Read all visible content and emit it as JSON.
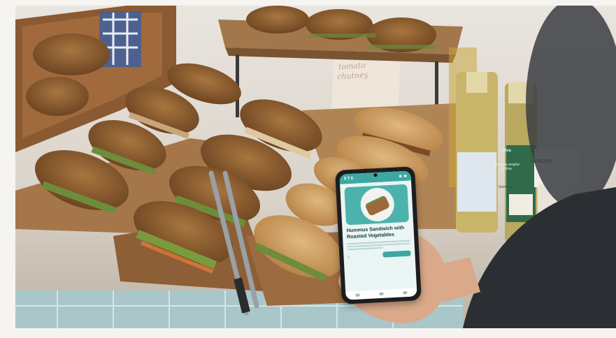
{
  "scene": {
    "description_hidden": "",
    "sign": {
      "line1": "tomato",
      "line2": "chutney"
    },
    "bottle_labels": {
      "label_brand": "oliva",
      "label_oil": "olio extra vergine di oliva",
      "label_variant": "rosmarino",
      "box_text": "VERGINE"
    }
  },
  "phone": {
    "app_name": "STX",
    "product_title": "Hummus Sandwich with Roasted Vegetables",
    "product_price": "€",
    "icons": [
      "search-icon",
      "cart-icon"
    ]
  },
  "colors": {
    "app_accent": "#3ea7a1",
    "screen_bg": "#eaf5f4"
  }
}
